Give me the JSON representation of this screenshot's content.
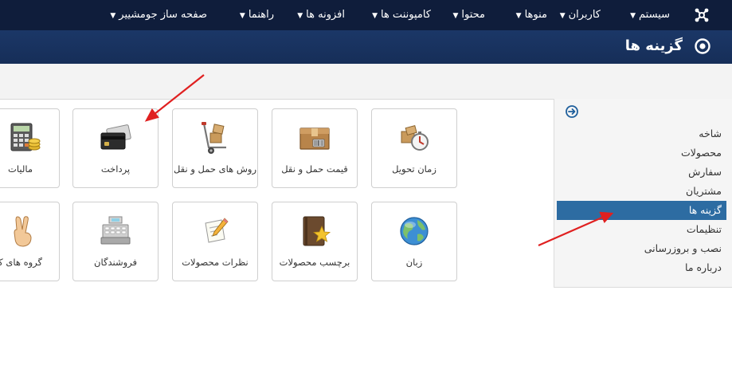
{
  "navbar": {
    "items": [
      {
        "label": "سیستم"
      },
      {
        "label": "کاربران"
      },
      {
        "label": "منوها"
      },
      {
        "label": "محتوا"
      },
      {
        "label": "کامپوننت ها"
      },
      {
        "label": "افزونه ها"
      },
      {
        "label": "راهنما"
      },
      {
        "label": "صفحه ساز جومشییر"
      }
    ]
  },
  "header": {
    "title": "گزینه ها"
  },
  "sidebar": {
    "items": [
      {
        "label": "شاخه"
      },
      {
        "label": "محصولات"
      },
      {
        "label": "سفارش"
      },
      {
        "label": "مشتریان"
      },
      {
        "label": "گزینه ها",
        "active": true
      },
      {
        "label": "تنظیمات"
      },
      {
        "label": "نصب و بروزرسانی"
      },
      {
        "label": "درباره ما"
      }
    ]
  },
  "tiles": [
    {
      "label": "زمان تحویل",
      "icon": "delivery-time-icon"
    },
    {
      "label": "قیمت حمل و نقل",
      "icon": "shipping-price-icon"
    },
    {
      "label": "روش های حمل و نقل",
      "icon": "shipping-methods-icon"
    },
    {
      "label": "پرداخت",
      "icon": "payment-card-icon"
    },
    {
      "label": "مالیات",
      "icon": "tax-calculator-icon"
    },
    {
      "label": "زبان",
      "icon": "globe-icon"
    },
    {
      "label": "برچسب محصولات",
      "icon": "product-label-icon"
    },
    {
      "label": "نظرات محصولات",
      "icon": "product-reviews-icon"
    },
    {
      "label": "فروشندگان",
      "icon": "vendors-register-icon"
    },
    {
      "label": "گروه های کاربران",
      "icon": "user-groups-icon"
    }
  ],
  "colors": {
    "navbar": "#0f1d3b",
    "titlebar": "#1b3767",
    "active_item": "#2d6ca2",
    "arrow": "#e02020"
  }
}
